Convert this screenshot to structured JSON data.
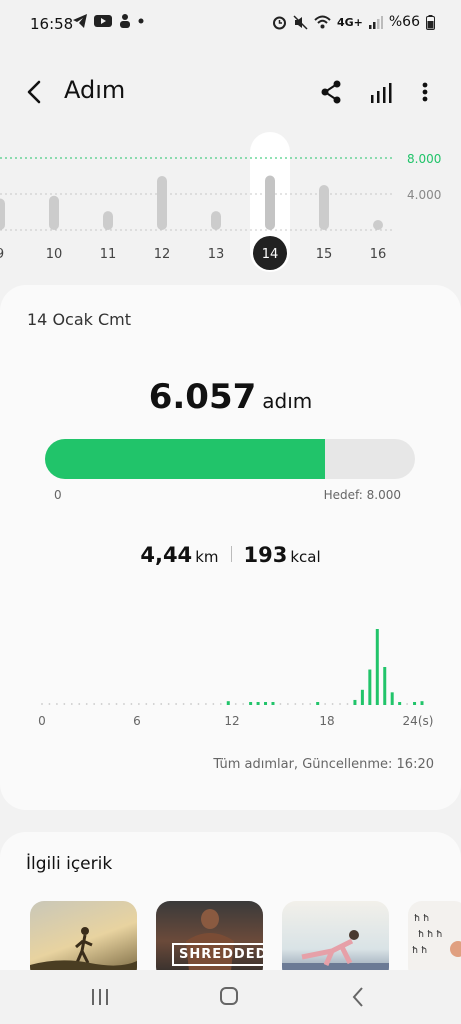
{
  "status_bar": {
    "time": "16:58",
    "battery_text": "%66",
    "network_text": "4G+"
  },
  "app_bar": {
    "title": "Adım"
  },
  "week_chart": {
    "days": [
      "9",
      "10",
      "11",
      "12",
      "13",
      "14",
      "15",
      "16"
    ],
    "values": [
      3500,
      3800,
      2100,
      6000,
      2100,
      6057,
      5000,
      900
    ],
    "selected_day": "14",
    "goal_label": "8.000",
    "mid_label": "4.000",
    "max": 8000
  },
  "day_card": {
    "date": "14 Ocak Cmt",
    "steps": "6.057",
    "steps_unit": "adım",
    "progress_fraction": 0.757,
    "progress_start": "0",
    "goal": "Hedef: 8.000",
    "distance": "4,44",
    "distance_unit": "km",
    "calories": "193",
    "calories_unit": "kcal",
    "updated": "Tüm adımlar, Güncellenme: 16:20"
  },
  "hourly_chart": {
    "x_labels": [
      "0",
      "6",
      "12",
      "18",
      "24(s)"
    ],
    "bars": [
      0,
      0,
      0,
      0,
      0,
      0,
      0,
      0,
      0,
      0,
      0,
      0,
      0,
      0,
      0,
      0,
      0,
      0,
      0,
      0,
      0,
      0,
      0,
      0,
      0,
      3,
      0,
      0,
      1,
      1,
      2,
      1,
      0,
      0,
      0,
      0,
      0,
      1,
      0,
      0,
      0,
      0,
      4,
      12,
      28,
      60,
      30,
      10,
      2,
      0,
      1,
      3
    ],
    "color": "#21c46a"
  },
  "related": {
    "heading": "İlgili içerik",
    "thumbs": [
      "",
      "SHREDDED",
      "",
      ""
    ]
  },
  "colors": {
    "accent": "#21c46a",
    "bar": "#cccccc",
    "selected": "#222222"
  }
}
